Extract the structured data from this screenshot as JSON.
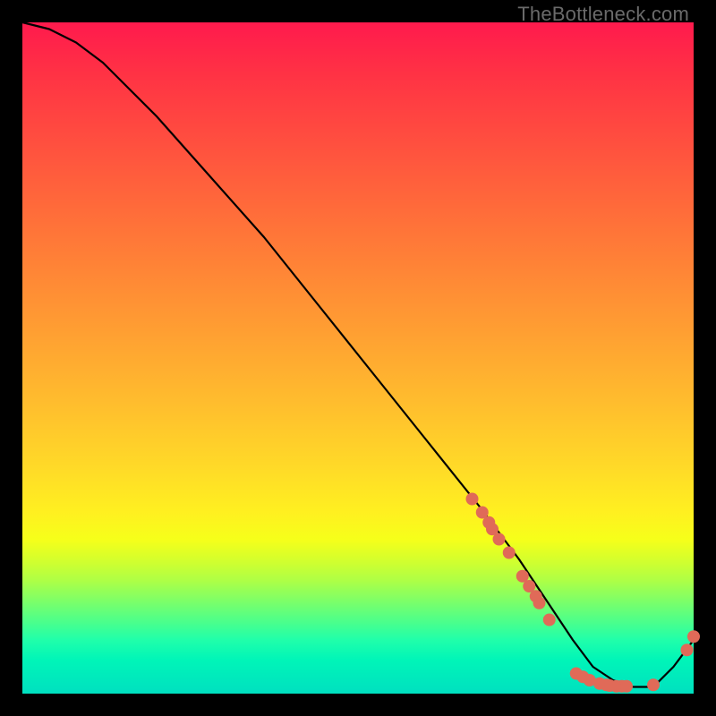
{
  "watermark": "TheBottleneck.com",
  "colors": {
    "background_border": "#000000",
    "curve": "#000000",
    "marker": "#e06a58"
  },
  "chart_data": {
    "type": "line",
    "title": "",
    "xlabel": "",
    "ylabel": "",
    "xlim": [
      0,
      100
    ],
    "ylim": [
      0,
      100
    ],
    "note": "Axes not labeled in source; x/y are percent of plot area (left-bottom origin). The curve is a gap/bottleneck profile descending from ~100% at x≈0 to ~0% near x≈85, with a shallow rise toward x=100. Markers cluster along the curve in the right portion.",
    "series": [
      {
        "name": "curve",
        "x": [
          0,
          4,
          8,
          12,
          16,
          20,
          28,
          36,
          44,
          52,
          60,
          68,
          74,
          78,
          82,
          85,
          88,
          91,
          94,
          97,
          100
        ],
        "y": [
          100,
          99,
          97,
          94,
          90,
          86,
          77,
          68,
          58,
          48,
          38,
          28,
          20,
          14,
          8,
          4,
          2,
          1,
          1,
          4,
          8
        ]
      }
    ],
    "markers": [
      {
        "x": 67.0,
        "y": 29.0
      },
      {
        "x": 68.5,
        "y": 27.0
      },
      {
        "x": 69.5,
        "y": 25.5
      },
      {
        "x": 70.0,
        "y": 24.5
      },
      {
        "x": 71.0,
        "y": 23.0
      },
      {
        "x": 72.5,
        "y": 21.0
      },
      {
        "x": 74.5,
        "y": 17.5
      },
      {
        "x": 75.5,
        "y": 16.0
      },
      {
        "x": 76.5,
        "y": 14.5
      },
      {
        "x": 77.0,
        "y": 13.5
      },
      {
        "x": 78.5,
        "y": 11.0
      },
      {
        "x": 82.5,
        "y": 3.0
      },
      {
        "x": 83.5,
        "y": 2.5
      },
      {
        "x": 84.5,
        "y": 2.0
      },
      {
        "x": 86.0,
        "y": 1.5
      },
      {
        "x": 87.0,
        "y": 1.3
      },
      {
        "x": 87.5,
        "y": 1.2
      },
      {
        "x": 88.5,
        "y": 1.1
      },
      {
        "x": 89.3,
        "y": 1.1
      },
      {
        "x": 90.0,
        "y": 1.1
      },
      {
        "x": 94.0,
        "y": 1.3
      },
      {
        "x": 99.0,
        "y": 6.5
      },
      {
        "x": 100.0,
        "y": 8.5
      }
    ]
  }
}
